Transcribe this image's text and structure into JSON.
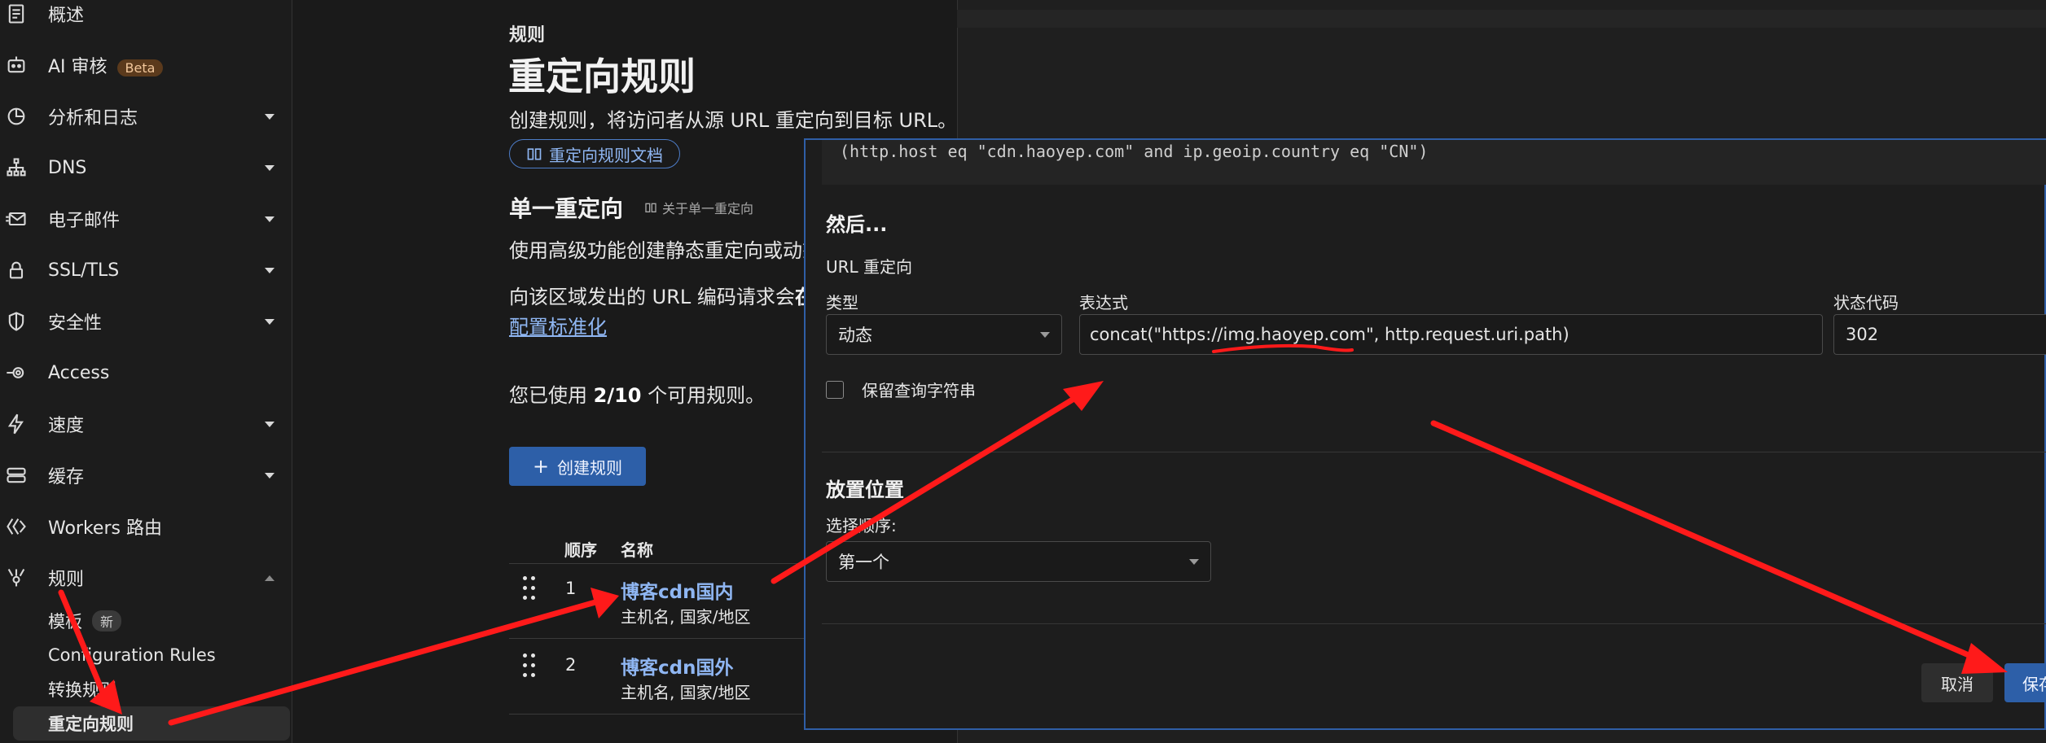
{
  "sidebar": {
    "items": [
      {
        "label": "概述",
        "icon": "document-icon",
        "has_caret": false
      },
      {
        "label": "AI 审核",
        "icon": "robot-icon",
        "badge": "Beta",
        "has_caret": false
      },
      {
        "label": "分析和日志",
        "icon": "chart-pie-icon",
        "has_caret": true
      },
      {
        "label": "DNS",
        "icon": "network-icon",
        "has_caret": true
      },
      {
        "label": "电子邮件",
        "icon": "mail-icon",
        "has_caret": true
      },
      {
        "label": "SSL/TLS",
        "icon": "lock-icon",
        "has_caret": true
      },
      {
        "label": "安全性",
        "icon": "shield-icon",
        "has_caret": true
      },
      {
        "label": "Access",
        "icon": "access-icon",
        "has_caret": false
      },
      {
        "label": "速度",
        "icon": "lightning-icon",
        "has_caret": true
      },
      {
        "label": "缓存",
        "icon": "storage-icon",
        "has_caret": true
      },
      {
        "label": "Workers 路由",
        "icon": "workers-icon",
        "has_caret": false
      },
      {
        "label": "规则",
        "icon": "rules-icon",
        "has_caret": true,
        "expanded": true
      }
    ],
    "sub_items": [
      {
        "label": "模板",
        "badge": "新"
      },
      {
        "label": "Configuration Rules"
      },
      {
        "label": "转换规则"
      },
      {
        "label": "重定向规则",
        "active": true
      }
    ]
  },
  "main": {
    "breadcrumb": "规则",
    "title": "重定向规则",
    "description": "创建规则，将访问者从源 URL 重定向到目标 URL。",
    "doc_button": "重定向规则文档",
    "section_title": "单一重定向",
    "about_link": "关于单一重定向",
    "single_desc": "使用高级功能创建静态重定向或动态",
    "encoding_desc_prefix": "向该区域发出的 URL 编码请求会",
    "encoding_desc_bold": "在",
    "normalization_link": "配置标准化",
    "usage_prefix": "您已使用 ",
    "usage_value": "2/10",
    "usage_suffix": " 个可用规则。",
    "create_button": "创建规则",
    "table": {
      "columns": {
        "order": "顺序",
        "name": "名称"
      },
      "rows": [
        {
          "order": "1",
          "name": "博客cdn国内",
          "sub": "主机名, 国家/地区"
        },
        {
          "order": "2",
          "name": "博客cdn国外",
          "sub": "主机名, 国家/地区"
        }
      ]
    }
  },
  "modal": {
    "expression_preview": "(http.host eq \"cdn.haoyep.com\" and ip.geoip.country eq \"CN\")",
    "then_title": "然后...",
    "redirect_type_label": "URL 重定向",
    "type_label": "类型",
    "type_value": "动态",
    "expression_label": "表达式",
    "expression_value": "concat(\"https://img.haoyep.com\", http.request.uri.path)",
    "status_label": "状态代码",
    "status_value": "302",
    "keep_query_label": "保留查询字符串",
    "placement_title": "放置位置",
    "order_label": "选择顺序:",
    "order_value": "第一个",
    "cancel_button": "取消",
    "save_button": "保存"
  },
  "colors": {
    "accent": "#2d5fa8",
    "link": "#8fb6f2",
    "annotation": "#ff1a1a",
    "beta_badge": "#5b3a1c"
  }
}
